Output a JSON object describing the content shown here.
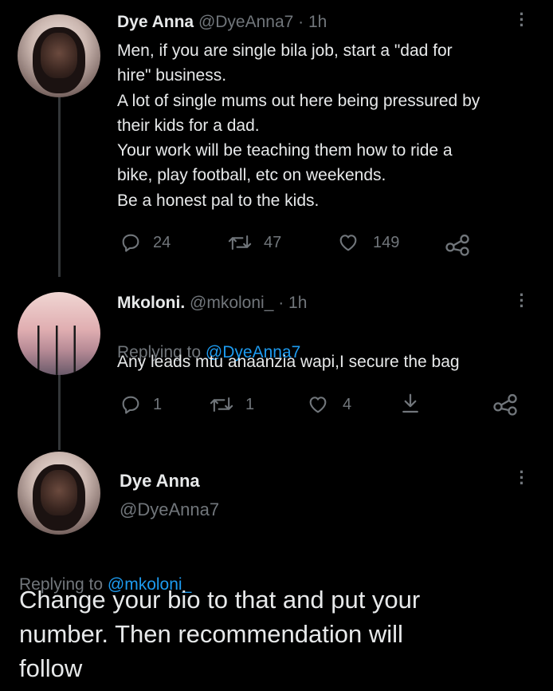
{
  "tweet1": {
    "display_name": "Dye Anna",
    "handle": "@DyeAnna7",
    "time": "· 1h",
    "text": "Men, if you are single bila job, start a \"dad for\nhire\" business.\nA lot of single mums out here being pressured by\ntheir kids for a dad.\nYour work will be teaching them how to ride a\nbike, play football, etc on weekends.\nBe a honest pal to the kids.",
    "replies": "24",
    "retweets": "47",
    "likes": "149"
  },
  "tweet2": {
    "display_name": "Mkoloni.",
    "handle": "@mkoloni_",
    "time": "· 1h",
    "replying_prefix": "Replying to ",
    "replying_to": "@DyeAnna7",
    "text": "Any leads mtu anaanzia wapi,I secure the bag",
    "replies": "1",
    "retweets": "1",
    "likes": "4"
  },
  "tweet3": {
    "display_name": "Dye Anna",
    "handle": "@DyeAnna7",
    "replying_prefix": "Replying to ",
    "replying_to": "@mkoloni_",
    "text": "Change your bio to that and put your\nnumber. Then recommendation will\nfollow"
  },
  "icons": {
    "reply": "reply-icon",
    "retweet": "retweet-icon",
    "like": "heart-icon",
    "share": "share-icon",
    "download": "download-icon",
    "more": "more-icon"
  },
  "colors": {
    "background": "#000000",
    "text": "#e7e9ea",
    "muted": "#71767b",
    "link": "#1d9bf0"
  }
}
